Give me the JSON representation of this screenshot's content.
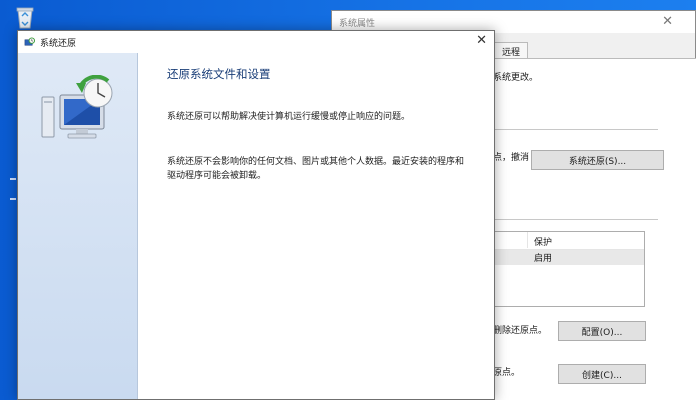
{
  "desktop": {
    "icons": {
      "recycle": "recycle-bin-icon"
    }
  },
  "system_properties": {
    "title": "系统属性",
    "tab_label": "远程",
    "text_changes": "系统更改。",
    "text_undo": "点，撤消",
    "restore_button": "系统还原(S)...",
    "list_header_protection": "保护",
    "list_row_status": "启用",
    "text_delete_points": "删除还原点。",
    "configure_button": "配置(O)...",
    "text_restore_point": "原点。",
    "create_button": "创建(C)..."
  },
  "system_restore": {
    "title": "系统还原",
    "heading": "还原系统文件和设置",
    "para1": "系统还原可以帮助解决使计算机运行缓慢或停止响应的问题。",
    "para2_line1": "系统还原不会影响你的任何文档、图片或其他个人数据。最近安装的程序和",
    "para2_line2": "驱动程序可能会被卸载。",
    "icons": {
      "title_icon": "system-restore-icon",
      "hero": "system-restore-computer-icon",
      "close": "close-icon"
    }
  },
  "colors": {
    "desktop": "#0a5bd1",
    "restore_sidebar": "#dfe9f6",
    "heading": "#1a3e78"
  }
}
